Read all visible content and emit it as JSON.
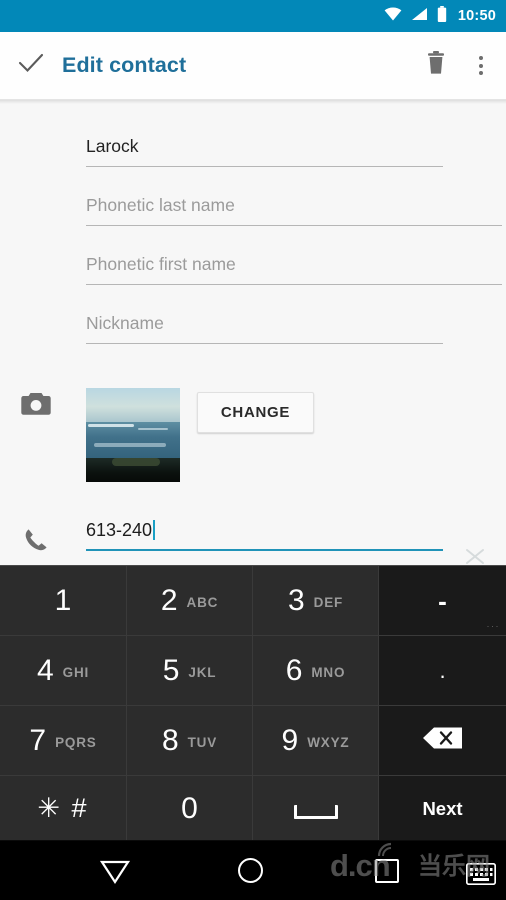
{
  "statusbar": {
    "time": "10:50",
    "icons": [
      "wifi-icon",
      "signal-icon",
      "battery-icon"
    ],
    "background": "#0288b8"
  },
  "toolbar": {
    "done_icon": "check-icon",
    "title": "Edit contact",
    "title_color": "#1f6f9a",
    "delete_icon": "trash-icon",
    "overflow_icon": "more-vertical-icon"
  },
  "form": {
    "fields": [
      {
        "name": "last-name",
        "value": "Larock",
        "is_placeholder": false,
        "underline_width": 357
      },
      {
        "name": "phonetic-last",
        "value": "Phonetic last name",
        "is_placeholder": true,
        "underline_width": 416
      },
      {
        "name": "phonetic-first",
        "value": "Phonetic first name",
        "is_placeholder": true,
        "underline_width": 416
      },
      {
        "name": "nickname",
        "value": "Nickname",
        "is_placeholder": true,
        "underline_width": 357
      }
    ],
    "photo_row": {
      "icon": "camera-icon",
      "thumbnail_alt": "seascape-photo",
      "change_label": "CHANGE"
    },
    "phone_row": {
      "icon": "phone-icon",
      "value": "613-240",
      "clear_icon": "close-icon",
      "accent": "#2093b8"
    }
  },
  "keyboard": {
    "background": "#2b2b2b",
    "sidecol_background": "#1a1a1a",
    "rows": [
      [
        {
          "name": "key-1",
          "num": "1",
          "letters": "",
          "type": "num"
        },
        {
          "name": "key-2",
          "num": "2",
          "letters": "ABC",
          "type": "num"
        },
        {
          "name": "key-3",
          "num": "3",
          "letters": "DEF",
          "type": "num"
        },
        {
          "name": "key-dash",
          "sym": "-",
          "type": "dash",
          "hint": "···"
        }
      ],
      [
        {
          "name": "key-4",
          "num": "4",
          "letters": "GHI",
          "type": "num"
        },
        {
          "name": "key-5",
          "num": "5",
          "letters": "JKL",
          "type": "num"
        },
        {
          "name": "key-6",
          "num": "6",
          "letters": "MNO",
          "type": "num"
        },
        {
          "name": "key-period",
          "sym": ".",
          "type": "sym"
        }
      ],
      [
        {
          "name": "key-7",
          "num": "7",
          "letters": "PQRS",
          "type": "num"
        },
        {
          "name": "key-8",
          "num": "8",
          "letters": "TUV",
          "type": "num"
        },
        {
          "name": "key-9",
          "num": "9",
          "letters": "WXYZ",
          "type": "num"
        },
        {
          "name": "key-backspace",
          "type": "backspace",
          "icon": "backspace-icon"
        }
      ],
      [
        {
          "name": "key-star-hash",
          "sym": "✳ #",
          "type": "star"
        },
        {
          "name": "key-0",
          "num": "0",
          "letters": "",
          "type": "num"
        },
        {
          "name": "key-space",
          "type": "space",
          "icon": "space-icon"
        },
        {
          "name": "key-next",
          "label": "Next",
          "type": "action"
        }
      ]
    ]
  },
  "navbar": {
    "back_icon": "back-triangle-icon",
    "home_icon": "home-circle-icon",
    "recents_icon": "recents-square-icon",
    "keyboard_icon": "keyboard-icon"
  },
  "watermark": {
    "text": "d.cn",
    "text_cn": "当乐网"
  }
}
